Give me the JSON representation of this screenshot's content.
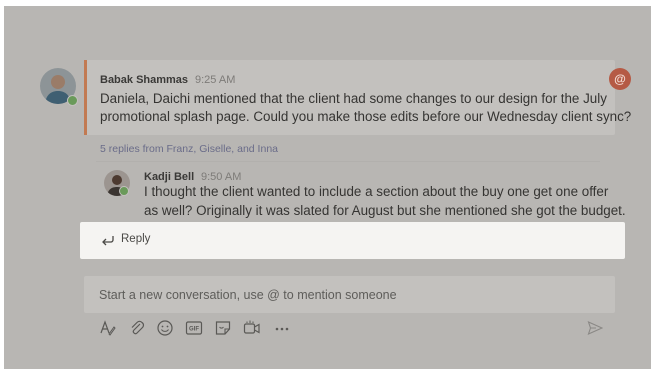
{
  "post": {
    "sender": "Babak Shammas",
    "time": "9:25 AM",
    "message_line1": "Daniela, Daichi mentioned that the client had some changes to our design for the July",
    "message_line2": "promotional splash page. Could you make those edits before our Wednesday client sync?",
    "mention_symbol": "@"
  },
  "replies_link": "5 replies from Franz, Giselle, and Inna",
  "reply": {
    "sender": "Kadji Bell",
    "time": "9:50 AM",
    "message_line1": "I thought the client wanted to include a section about the buy one get one offer",
    "message_line2": "as well? Originally it was slated for August but she mentioned she got the budget."
  },
  "reply_box": {
    "label": "Reply",
    "icon": "reply-arrow-icon"
  },
  "compose": {
    "placeholder": "Start a new conversation, use @ to mention someone"
  },
  "toolbar": {
    "icons": [
      "format-icon",
      "attach-icon",
      "emoji-icon",
      "gif-icon",
      "sticker-icon",
      "meet-now-icon",
      "more-options-icon",
      "send-icon"
    ],
    "gif_label": "GIF"
  },
  "colors": {
    "overlay": "#b8b6b3",
    "card": "#c3c1be",
    "accent": "#c27a52",
    "mention": "#b55a45",
    "highlight": "#f5f4f2",
    "presence": "#6a9a5a"
  }
}
